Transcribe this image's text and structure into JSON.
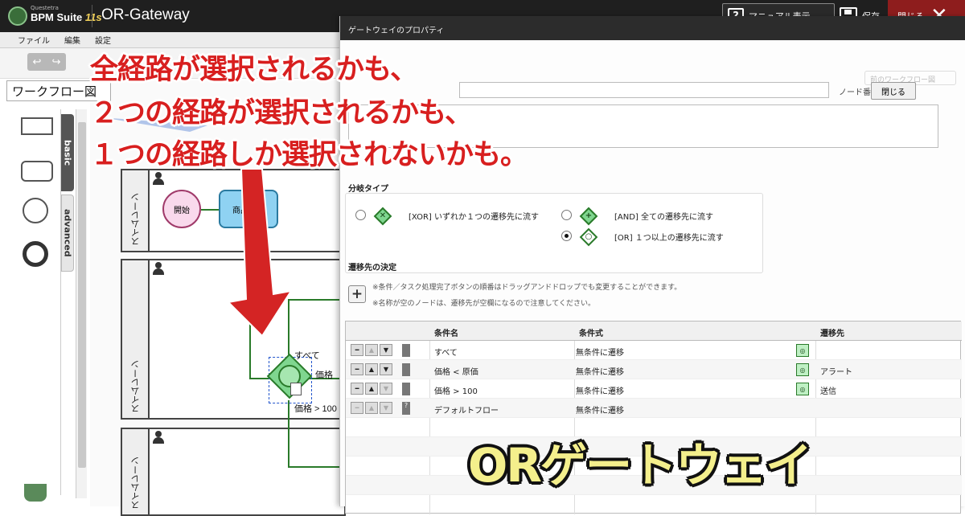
{
  "app": {
    "brand_small": "Questetra",
    "brand": "BPM Suite",
    "version": "11s",
    "title": "OR-Gateway",
    "manual_label": "マニュアル表示",
    "save_label": "保存",
    "close_label": "閉じる"
  },
  "menu": [
    "ファイル",
    "編集",
    "設定"
  ],
  "workflow_tab": "ワークフロー図",
  "palette_tabs": {
    "basic": "basic",
    "advanced": "advanced"
  },
  "diagram": {
    "lane_label": "スイムレーン",
    "start_label": "開始",
    "task_label": "商品企画",
    "flow_all": "すべて",
    "flow_price": "価格",
    "flow_price_gt": "価格 > 100"
  },
  "panel": {
    "title": "ゲートウェイのプロパティ",
    "search_placeholder": "前のワークフロー図",
    "node_number_label": "ノード番号 2",
    "close_button": "閉じる",
    "branch_type_label": "分岐タイプ",
    "options": [
      {
        "label": "[XOR] いずれか１つの遷移先に流す",
        "selected": false
      },
      {
        "label": "[AND] 全ての遷移先に流す",
        "selected": false
      },
      {
        "label": "[OR] １つ以上の遷移先に流す",
        "selected": true
      }
    ],
    "destination_label": "遷移先の決定",
    "notes": [
      "※条件／タスク処理完了ボタンの順番はドラッグアンドドロップでも変更することができます。",
      "※名称が空のノードは、遷移先が空欄になるので注意してください。"
    ],
    "columns": [
      "条件名",
      "条件式",
      "遷移先"
    ],
    "rows": [
      {
        "name": "すべて",
        "expr": "無条件に遷移",
        "dest": "",
        "mark": "◎"
      },
      {
        "name": "価格 < 原価",
        "expr": "無条件に遷移",
        "dest": "アラート",
        "mark": "◎"
      },
      {
        "name": "価格 > 100",
        "expr": "無条件に遷移",
        "dest": "送信",
        "mark": "◎"
      },
      {
        "name": "デフォルトフロー",
        "expr": "無条件に遷移",
        "dest": "",
        "mark": "?"
      }
    ]
  },
  "overlay": {
    "headline": [
      "全経路が選択されるかも、",
      "２つの経路が選択されるかも、",
      "１つの経路しか選択されないかも。"
    ],
    "title": "ORゲートウェイ"
  },
  "colors": {
    "headline": "#d81f1f",
    "title_fill": "#f4ef8c",
    "arrow": "#d42424",
    "gateway": "#7fd68f"
  }
}
